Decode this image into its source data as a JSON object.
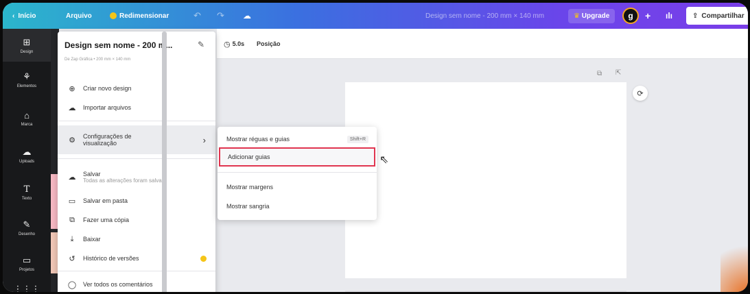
{
  "topbar": {
    "back": "Início",
    "file": "Arquivo",
    "resize": "Redimensionar",
    "doc_title": "Design sem nome - 200 mm × 140 mm",
    "upgrade": "Upgrade",
    "avatar": "g",
    "plus": "+",
    "share": "Compartilhar"
  },
  "rail": {
    "items": [
      {
        "label": "Design",
        "icon": "layout-icon"
      },
      {
        "label": "Elementos",
        "icon": "shapes-icon"
      },
      {
        "label": "Marca",
        "icon": "brand-icon"
      },
      {
        "label": "Uploads",
        "icon": "upload-icon"
      },
      {
        "label": "Texto",
        "icon": "text-icon"
      },
      {
        "label": "Desenho",
        "icon": "draw-icon"
      },
      {
        "label": "Projetos",
        "icon": "folder-icon"
      }
    ]
  },
  "toolbar": {
    "duration": "5.0s",
    "position": "Posição"
  },
  "menu": {
    "title": "Design sem nome - 200 m...",
    "subtitle": "De Zap Gráfica • 200 mm × 140 mm",
    "items": {
      "new": "Criar novo design",
      "import": "Importar arquivos",
      "view_settings_1": "Configurações de",
      "view_settings_2": "visualização",
      "save": "Salvar",
      "save_sub": "Todas as alterações foram salvas",
      "save_folder": "Salvar em pasta",
      "copy": "Fazer uma cópia",
      "download": "Baixar",
      "history": "Histórico de versões",
      "comments": "Ver todos os comentários"
    }
  },
  "submenu": {
    "show_rulers": "Mostrar réguas e guias",
    "show_rulers_kbd": "Shift+R",
    "add_guides": "Adicionar guias",
    "show_margins": "Mostrar margens",
    "show_bleed": "Mostrar sangria"
  },
  "colors": {
    "highlight_box": "#e0344f",
    "crown": "#f5c518"
  }
}
